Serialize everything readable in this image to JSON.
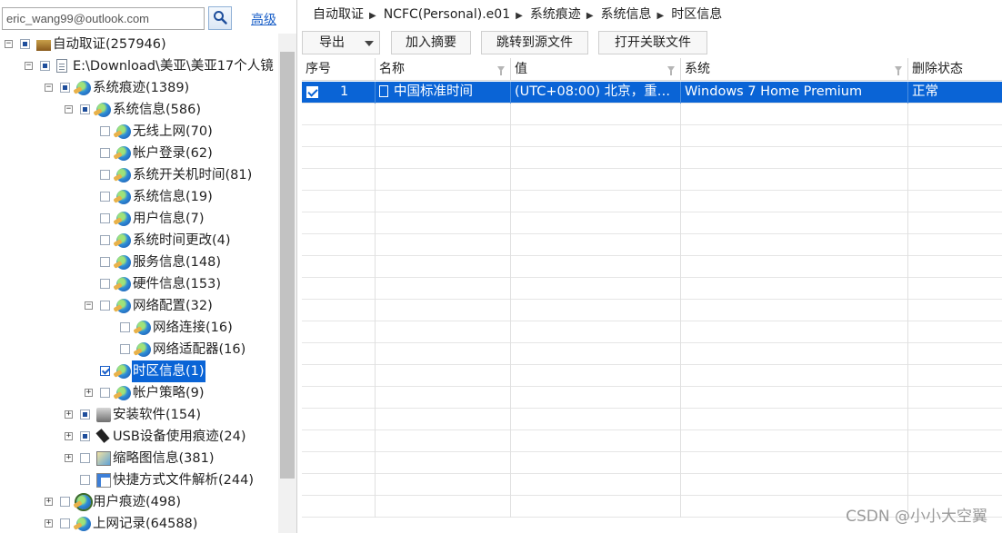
{
  "search": {
    "value": "eric_wang99@outlook.com",
    "advanced_label": "高级"
  },
  "tree": [
    {
      "label": "自动取证(257946)",
      "icon": "case-icon",
      "exp": "-",
      "cb": "partial",
      "indent": 0
    },
    {
      "label": "E:\\Download\\美亚\\美亚17个人镜",
      "icon": "document-icon",
      "exp": "-",
      "cb": "partial",
      "indent": 1
    },
    {
      "label": "系统痕迹(1389)",
      "icon": "globe-icon",
      "exp": "-",
      "cb": "partial",
      "indent": 2
    },
    {
      "label": "系统信息(586)",
      "icon": "globe-icon",
      "exp": "-",
      "cb": "partial",
      "indent": 3
    },
    {
      "label": "无线上网(70)",
      "icon": "globe-icon",
      "exp": "",
      "cb": "empty",
      "indent": 4
    },
    {
      "label": "帐户登录(62)",
      "icon": "globe-icon",
      "exp": "",
      "cb": "empty",
      "indent": 4
    },
    {
      "label": "系统开关机时间(81)",
      "icon": "globe-icon",
      "exp": "",
      "cb": "empty",
      "indent": 4
    },
    {
      "label": "系统信息(19)",
      "icon": "globe-icon",
      "exp": "",
      "cb": "empty",
      "indent": 4
    },
    {
      "label": "用户信息(7)",
      "icon": "globe-icon",
      "exp": "",
      "cb": "empty",
      "indent": 4
    },
    {
      "label": "系统时间更改(4)",
      "icon": "globe-icon",
      "exp": "",
      "cb": "empty",
      "indent": 4
    },
    {
      "label": "服务信息(148)",
      "icon": "globe-icon",
      "exp": "",
      "cb": "empty",
      "indent": 4
    },
    {
      "label": "硬件信息(153)",
      "icon": "globe-icon",
      "exp": "",
      "cb": "empty",
      "indent": 4
    },
    {
      "label": "网络配置(32)",
      "icon": "globe-icon",
      "exp": "-",
      "cb": "empty",
      "indent": 4
    },
    {
      "label": "网络连接(16)",
      "icon": "globe-icon",
      "exp": "",
      "cb": "empty",
      "indent": 5
    },
    {
      "label": "网络适配器(16)",
      "icon": "globe-icon",
      "exp": "",
      "cb": "empty",
      "indent": 5
    },
    {
      "label": "时区信息(1)",
      "icon": "globe-icon",
      "exp": "",
      "cb": "checked",
      "indent": 4,
      "selected": true
    },
    {
      "label": "帐户策略(9)",
      "icon": "globe-icon",
      "exp": "+",
      "cb": "empty",
      "indent": 4
    },
    {
      "label": "安装软件(154)",
      "icon": "installer-icon",
      "exp": "+",
      "cb": "partial",
      "indent": 3
    },
    {
      "label": "USB设备使用痕迹(24)",
      "icon": "usb-icon",
      "exp": "+",
      "cb": "partial",
      "indent": 3
    },
    {
      "label": "缩略图信息(381)",
      "icon": "thumbnail-icon",
      "exp": "+",
      "cb": "empty",
      "indent": 3
    },
    {
      "label": "快捷方式文件解析(244)",
      "icon": "shortcut-icon",
      "exp": "",
      "cb": "empty",
      "indent": 3
    },
    {
      "label": "用户痕迹(498)",
      "icon": "user-globe-icon",
      "exp": "+",
      "cb": "empty",
      "indent": 2
    },
    {
      "label": "上网记录(64588)",
      "icon": "globe-icon",
      "exp": "+",
      "cb": "empty",
      "indent": 2
    }
  ],
  "breadcrumb": [
    "自动取证",
    "NCFC(Personal).e01",
    "系统痕迹",
    "系统信息",
    "时区信息"
  ],
  "toolbar": {
    "export_label": "导出",
    "add_summary_label": "加入摘要",
    "jump_source_label": "跳转到源文件",
    "open_related_label": "打开关联文件"
  },
  "grid": {
    "columns": [
      "序号",
      "名称",
      "值",
      "系统",
      "删除状态"
    ],
    "rows": [
      {
        "index": "1",
        "name": "中国标准时间",
        "value": "(UTC+08:00) 北京，重庆…",
        "system": "Windows 7 Home Premium",
        "status": "正常"
      }
    ]
  },
  "watermark": "CSDN @小小大空翼",
  "colors": {
    "selection": "#0a64d6",
    "link": "#1a5fc8"
  }
}
